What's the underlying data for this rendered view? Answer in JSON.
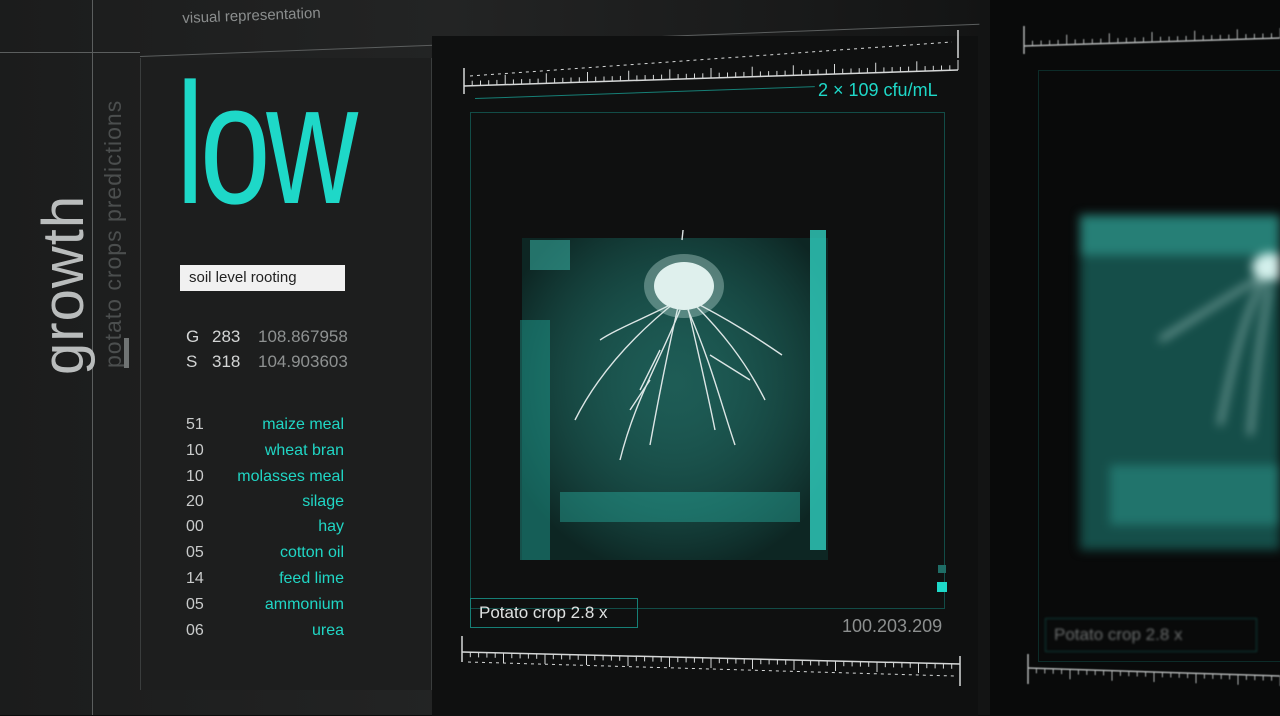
{
  "header": {
    "title": "visual representation"
  },
  "sidebar": {
    "title": "growth",
    "subtitle": "potato crops predictions"
  },
  "status": {
    "level": "low",
    "badge": "soil level rooting"
  },
  "metrics": [
    {
      "label": "G",
      "value": "283",
      "coord": "108.867958"
    },
    {
      "label": "S",
      "value": "318",
      "coord": "104.903603"
    }
  ],
  "ingredients": [
    {
      "qty": "51",
      "name": "maize meal"
    },
    {
      "qty": "10",
      "name": "wheat bran"
    },
    {
      "qty": "10",
      "name": "molasses meal"
    },
    {
      "qty": "20",
      "name": "silage"
    },
    {
      "qty": "00",
      "name": "hay"
    },
    {
      "qty": "05",
      "name": "cotton oil"
    },
    {
      "qty": "14",
      "name": "feed lime"
    },
    {
      "qty": "05",
      "name": "ammonium"
    },
    {
      "qty": "06",
      "name": "urea"
    }
  ],
  "visual": {
    "concentration": "2 × 109 cfu/mL",
    "caption": "Potato crop 2.8 x",
    "coordinate": "100.203.209"
  },
  "secondary": {
    "caption": "Potato crop 2.8 x"
  },
  "colors": {
    "accent": "#1ed8c8",
    "panel": "#1d1e1e",
    "background": "#0b0c0c",
    "badge": "#f1f1f1"
  }
}
